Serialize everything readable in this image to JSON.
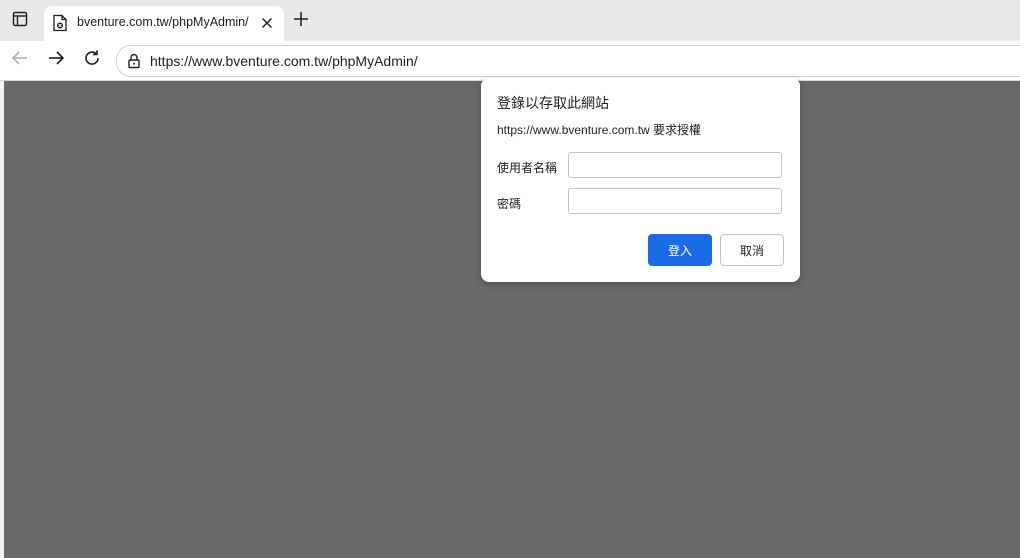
{
  "tab": {
    "title": "bventure.com.tw/phpMyAdmin/",
    "favicon": "page-error-icon",
    "close_icon": "close-icon"
  },
  "toolbar": {
    "back_icon": "arrow-left-icon",
    "forward_icon": "arrow-right-icon",
    "reload_icon": "reload-icon",
    "site_info_icon": "lock-icon",
    "url": "https://www.bventure.com.tw/phpMyAdmin/"
  },
  "dialog": {
    "title": "登錄以存取此網站",
    "description": "https://www.bventure.com.tw 要求授權",
    "username_label": "使用者名稱",
    "username_value": "",
    "password_label": "密碼",
    "password_value": "",
    "signin_label": "登入",
    "cancel_label": "取消"
  },
  "colors": {
    "accent": "#1a6ce6",
    "content_overlay": "#696969",
    "tabstrip": "#e8e8e8"
  }
}
